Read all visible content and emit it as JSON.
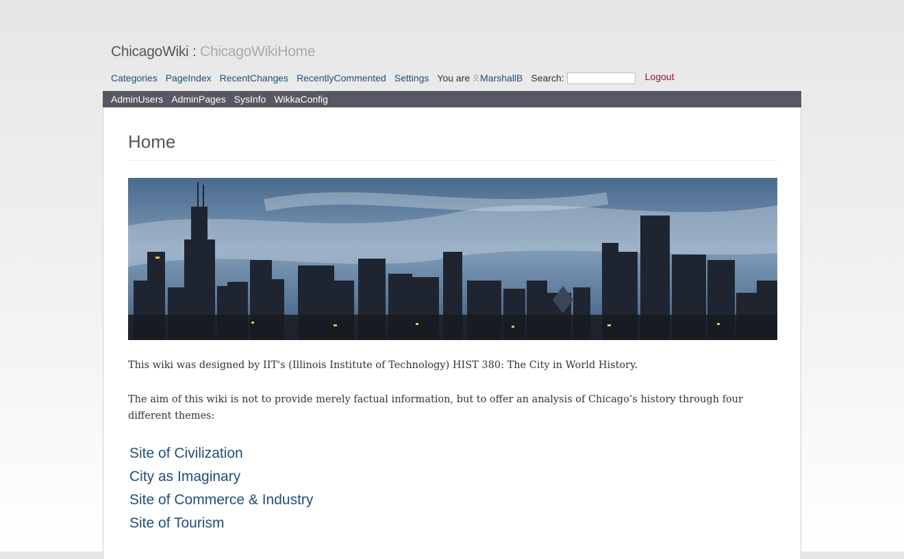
{
  "header": {
    "site_name": "ChicagoWiki",
    "separator": " : ",
    "page_name": "ChicagoWikiHome"
  },
  "nav": {
    "items": [
      "Categories",
      "PageIndex",
      "RecentChanges",
      "RecentlyCommented",
      "Settings"
    ],
    "you_are": "You are",
    "user": "MarshallB",
    "search_label": "Search:",
    "search_value": "",
    "logout": "Logout"
  },
  "admin": {
    "items": [
      "AdminUsers",
      "AdminPages",
      "SysInfo",
      "WikkaConfig"
    ]
  },
  "main": {
    "title": "Home",
    "banner_icon": "chicago-skyline-photo",
    "paragraphs": [
      "This wiki was designed by IIT's (Illinois Institute of Technology) HIST 380: The City in World History.",
      "The aim of this wiki is not to provide merely factual information, but to offer an analysis of Chicago’s history through four different themes:"
    ],
    "themes": [
      "Site of Civilization",
      "City as Imaginary",
      "Site of Commerce & Industry",
      "Site of Tourism"
    ]
  },
  "colors": {
    "link": "#1f4e79",
    "logout": "#8b1538",
    "adminbar": "#585864"
  }
}
